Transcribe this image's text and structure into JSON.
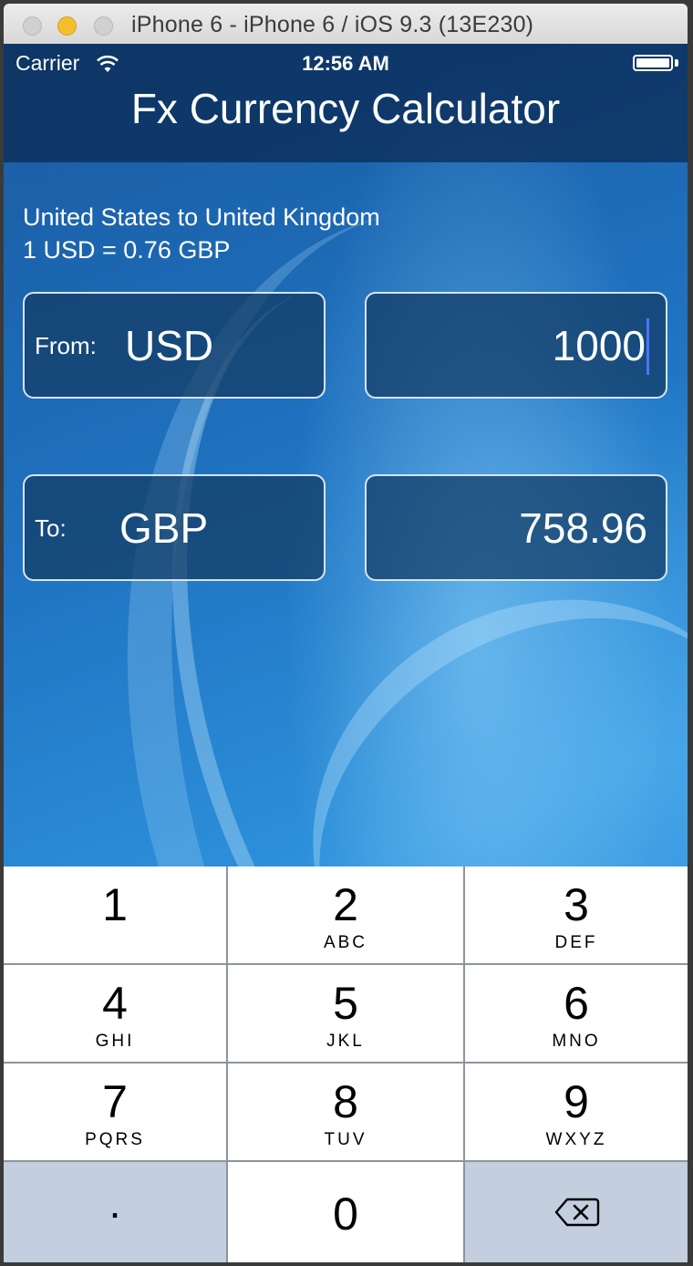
{
  "window": {
    "title": "iPhone 6 - iPhone 6 / iOS 9.3 (13E230)"
  },
  "status_bar": {
    "carrier": "Carrier",
    "time": "12:56 AM"
  },
  "app": {
    "title": "Fx Currency Calculator"
  },
  "route": {
    "description": "United States to United Kingdom",
    "rate": "1 USD = 0.76 GBP"
  },
  "from": {
    "label": "From:",
    "currency": "USD",
    "amount": "1000"
  },
  "to": {
    "label": "To:",
    "currency": "GBP",
    "amount": "758.96"
  },
  "keypad": {
    "keys": [
      {
        "num": "1",
        "letters": ""
      },
      {
        "num": "2",
        "letters": "ABC"
      },
      {
        "num": "3",
        "letters": "DEF"
      },
      {
        "num": "4",
        "letters": "GHI"
      },
      {
        "num": "5",
        "letters": "JKL"
      },
      {
        "num": "6",
        "letters": "MNO"
      },
      {
        "num": "7",
        "letters": "PQRS"
      },
      {
        "num": "8",
        "letters": "TUV"
      },
      {
        "num": "9",
        "letters": "WXYZ"
      }
    ],
    "decimal": ".",
    "zero": "0",
    "delete_icon": "backspace-icon"
  },
  "colors": {
    "caret": "#4a76ff",
    "keypad_gray": "#c3cede"
  }
}
